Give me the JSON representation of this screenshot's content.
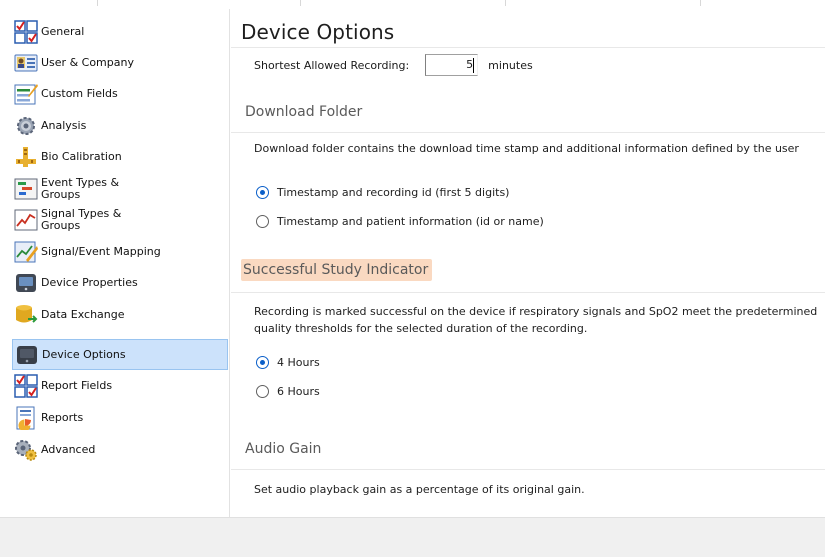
{
  "sidebar": {
    "selected_index": 10,
    "items": [
      {
        "label": "General",
        "icon": "general-checklist-icon"
      },
      {
        "label": "User & Company",
        "icon": "user-card-icon"
      },
      {
        "label": "Custom Fields",
        "icon": "custom-fields-form-icon"
      },
      {
        "label": "Analysis",
        "icon": "analysis-gears-icon"
      },
      {
        "label": "Bio Calibration",
        "icon": "bio-calibration-icon"
      },
      {
        "label": "Event Types &\nGroups",
        "icon": "event-types-icon"
      },
      {
        "label": "Signal Types &\nGroups",
        "icon": "signal-types-icon"
      },
      {
        "label": "Signal/Event Mapping",
        "icon": "signal-event-mapping-icon"
      },
      {
        "label": "Device Properties",
        "icon": "device-properties-icon"
      },
      {
        "label": "Data Exchange",
        "icon": "data-exchange-database-icon"
      },
      {
        "label": "Device Options",
        "icon": "device-options-icon"
      },
      {
        "label": "Report Fields",
        "icon": "report-fields-checklist-icon"
      },
      {
        "label": "Reports",
        "icon": "reports-document-icon"
      },
      {
        "label": "Advanced",
        "icon": "advanced-gears-icon"
      }
    ]
  },
  "main": {
    "title": "Device Options",
    "shortest_recording": {
      "label": "Shortest Allowed Recording:",
      "value": "5",
      "unit": "minutes"
    },
    "download_folder": {
      "heading": "Download Folder",
      "description": "Download folder contains the download time stamp and additional information defined by the user",
      "options": [
        {
          "label": "Timestamp and recording id (first 5 digits)",
          "checked": true
        },
        {
          "label": "Timestamp and patient information (id or name)",
          "checked": false
        }
      ]
    },
    "successful_study": {
      "heading": "Successful Study Indicator",
      "description": "Recording is marked successful on the device if respiratory signals and SpO2 meet the predetermined quality thresholds for the selected duration of the recording.",
      "options": [
        {
          "label": "4 Hours",
          "checked": true
        },
        {
          "label": "6 Hours",
          "checked": false
        }
      ]
    },
    "audio_gain": {
      "heading": "Audio Gain",
      "description": "Set audio playback gain as a percentage of its original gain."
    }
  },
  "colors": {
    "selection_background": "#cce2fb",
    "selection_border": "#99c4f0",
    "radio_checked": "#0a5fc9",
    "heading_highlight": "#fad9c1",
    "footer_background": "#f0f0f0"
  }
}
